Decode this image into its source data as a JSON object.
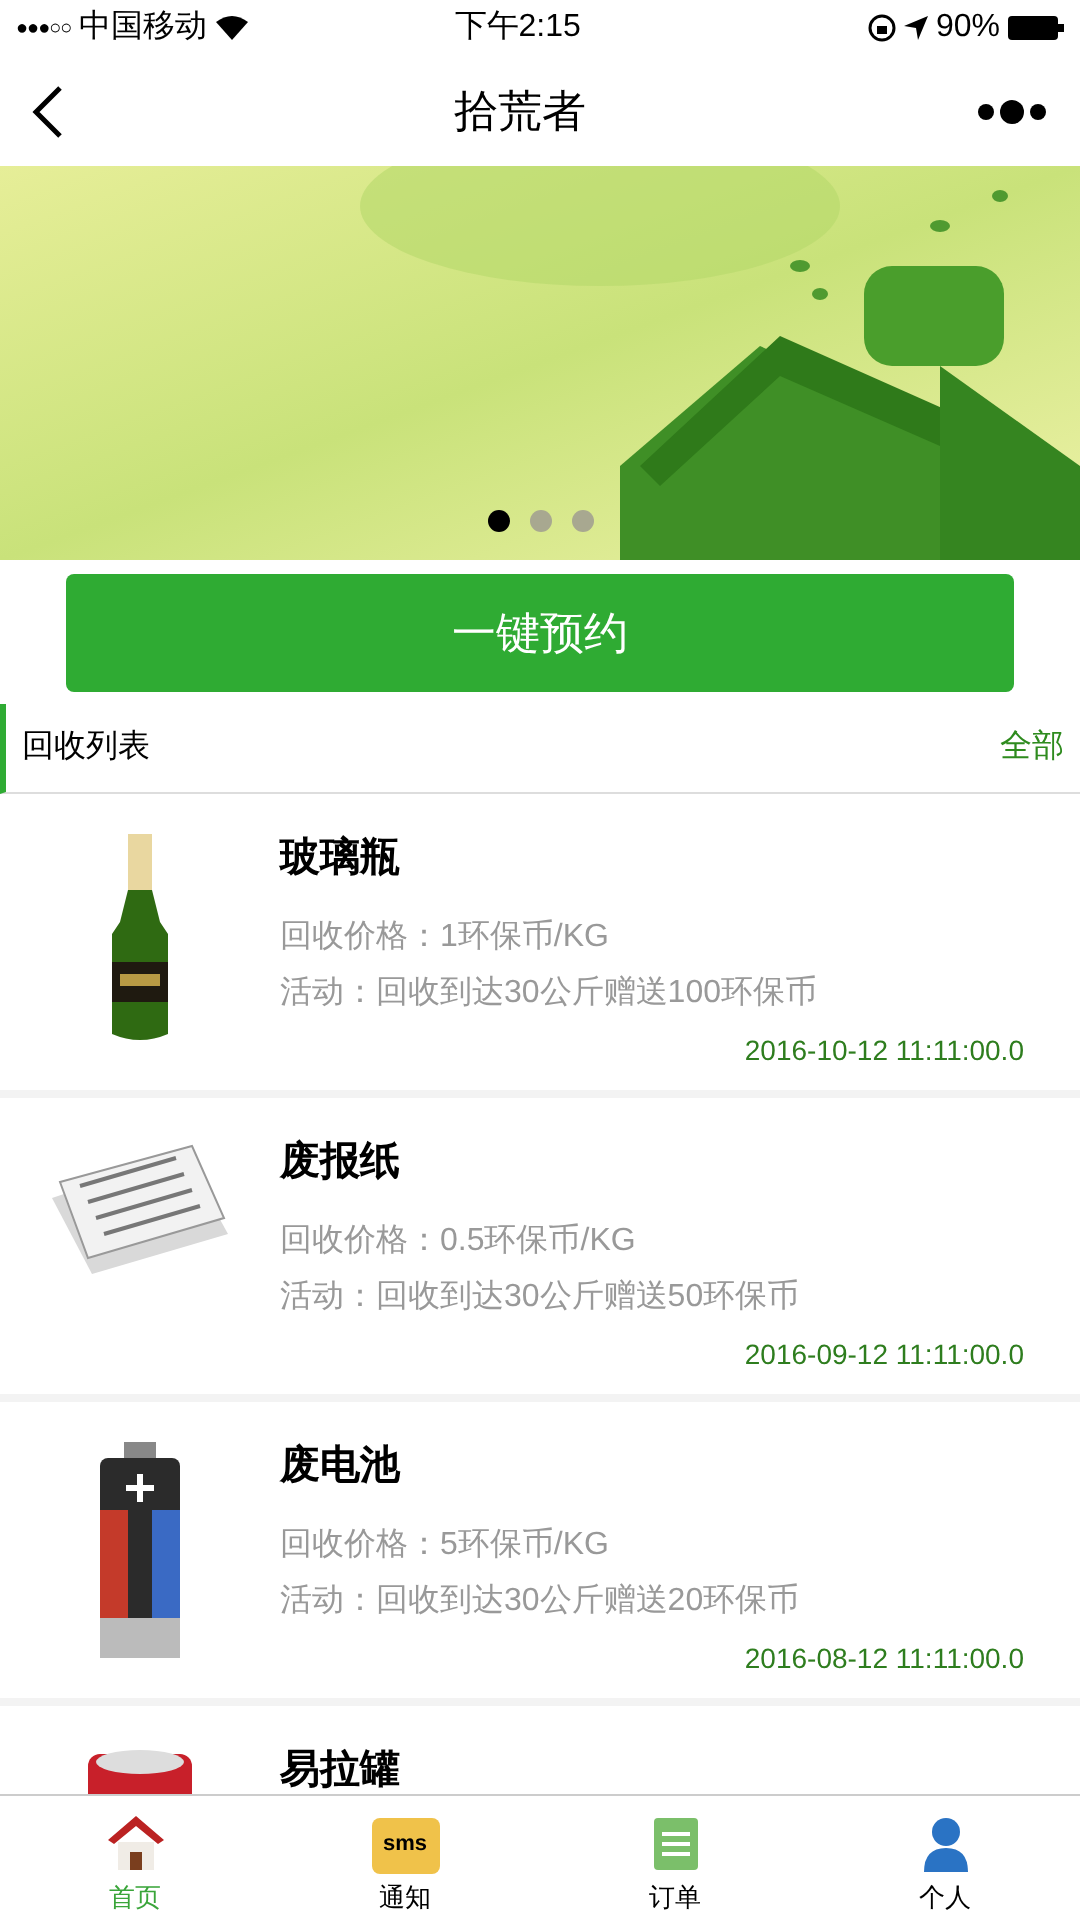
{
  "status_bar": {
    "signal_dots": "●●●○○",
    "carrier": "中国移动",
    "time": "下午2:15",
    "battery": "90%"
  },
  "nav": {
    "title": "拾荒者"
  },
  "banner": {
    "kind": "picture",
    "dots": [
      {
        "selected": true
      },
      {
        "selected": false
      },
      {
        "selected": false
      }
    ]
  },
  "book_button": "一键预约",
  "list_header": {
    "title": "回收列表",
    "link": "全部"
  },
  "items": [
    {
      "kind": "bottle",
      "name": "玻璃瓶",
      "price": "回收价格：1环保币/KG",
      "activity": "活动：回收到达30公斤赠送100环保币",
      "date": "2016-10-12 11:11:00.0"
    },
    {
      "kind": "newspaper",
      "name": "废报纸",
      "price": "回收价格：0.5环保币/KG",
      "activity": "活动：回收到达30公斤赠送50环保币",
      "date": "2016-09-12 11:11:00.0"
    },
    {
      "kind": "battery",
      "name": "废电池",
      "price": "回收价格：5环保币/KG",
      "activity": "活动：回收到达30公斤赠送20环保币",
      "date": "2016-08-12 11:11:00.0"
    },
    {
      "kind": "can",
      "name": "易拉罐"
    }
  ],
  "tab_bar": [
    {
      "kind": "home",
      "label": "首页",
      "selected": true
    },
    {
      "kind": "sms",
      "label": "通知",
      "sms": "sms",
      "selected": false
    },
    {
      "kind": "orders",
      "label": "订单",
      "selected": false
    },
    {
      "kind": "person",
      "label": "个人",
      "selected": false
    }
  ]
}
